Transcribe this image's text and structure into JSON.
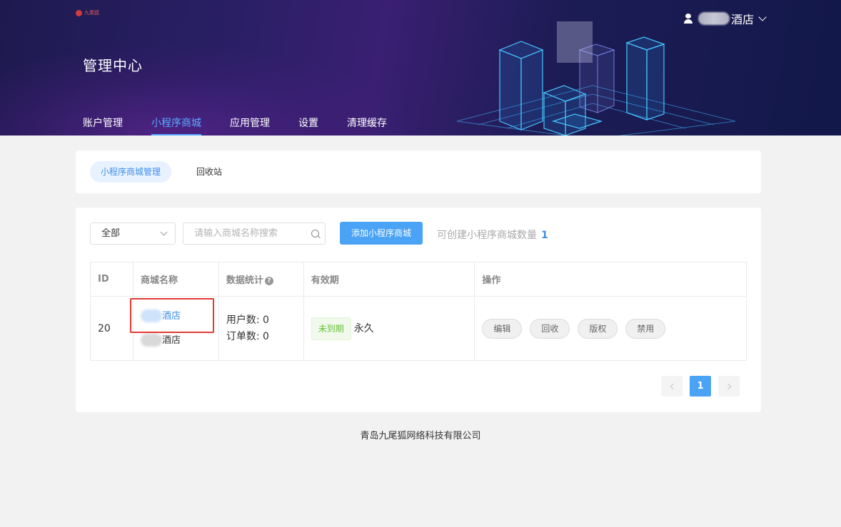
{
  "header": {
    "logo_text": "九尾狐",
    "title": "管理中心",
    "user_suffix": "酒店",
    "nav": [
      {
        "label": "账户管理",
        "active": false
      },
      {
        "label": "小程序商城",
        "active": true
      },
      {
        "label": "应用管理",
        "active": false
      },
      {
        "label": "设置",
        "active": false
      },
      {
        "label": "清理缓存",
        "active": false
      }
    ]
  },
  "subtabs": [
    {
      "label": "小程序商城管理",
      "active": true
    },
    {
      "label": "回收站",
      "active": false
    }
  ],
  "toolbar": {
    "filter_value": "全部",
    "search_placeholder": "请输入商城名称搜索",
    "add_button": "添加小程序商城",
    "quota_label": "可创建小程序商城数量",
    "quota_value": "1"
  },
  "table": {
    "headers": [
      "ID",
      "商城名称",
      "数据统计",
      "有效期",
      "操作"
    ],
    "rows": [
      {
        "id": "20",
        "name_link": "酒店",
        "name_sub": "酒店",
        "users": "用户数: 0",
        "orders": "订单数: 0",
        "status_tag": "未到期",
        "validity": "永久",
        "actions": [
          "编辑",
          "回收",
          "版权",
          "禁用"
        ]
      }
    ]
  },
  "pagination": {
    "current": "1"
  },
  "footer": {
    "company": "青岛九尾狐网络科技有限公司"
  },
  "colors": {
    "accent": "#4aa3f5",
    "header_bg": "#1e1a4f",
    "highlight_box": "#e53935",
    "tag_green": "#67c23a"
  }
}
